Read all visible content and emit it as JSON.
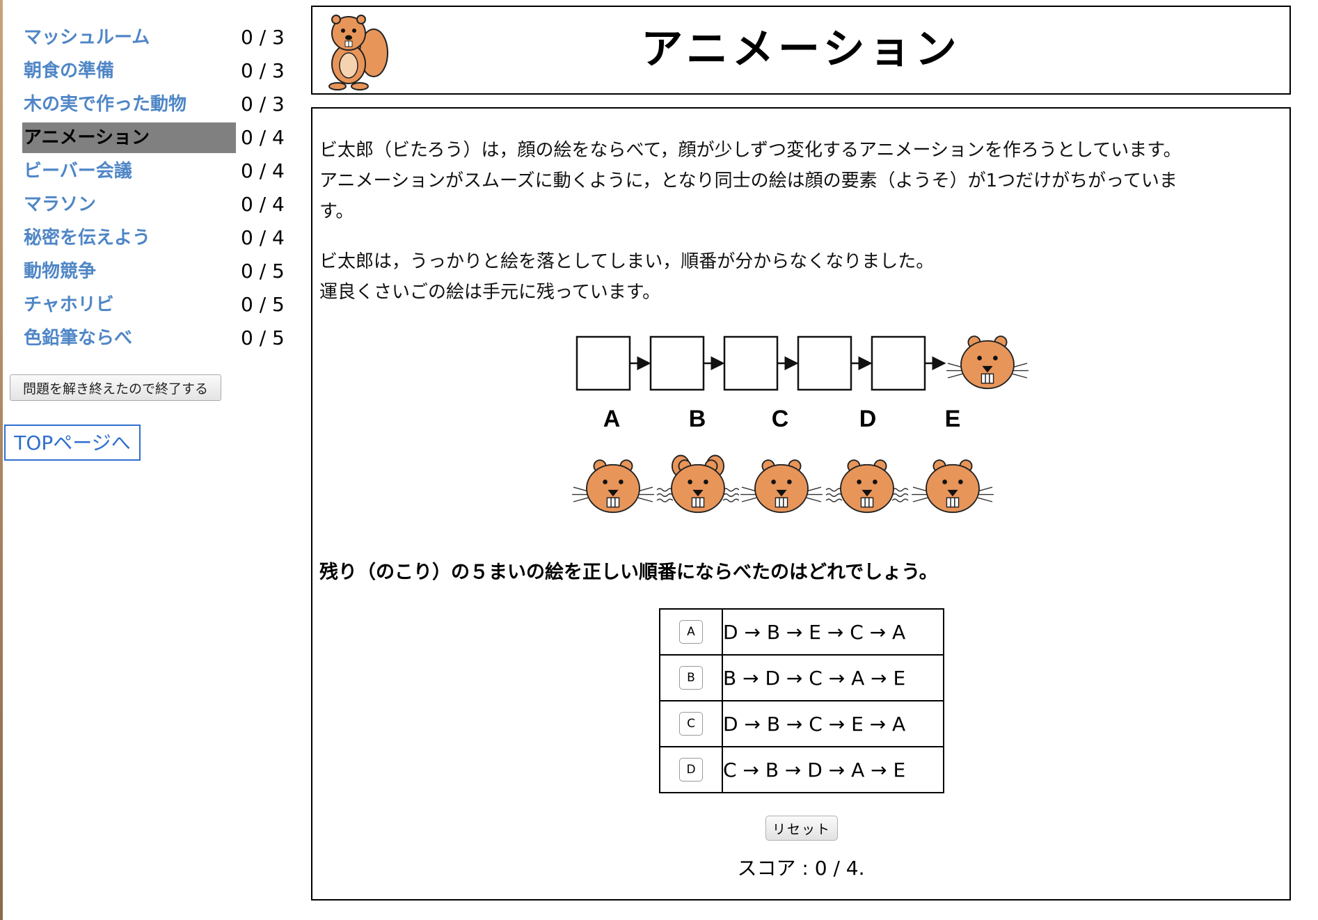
{
  "sidebar": {
    "tasks": [
      {
        "name": "マッシュルーム",
        "score": "0 / 3"
      },
      {
        "name": "朝食の準備",
        "score": "0 / 3"
      },
      {
        "name": "木の実で作った動物",
        "score": "0 / 3"
      },
      {
        "name": "アニメーション",
        "score": "0 / 4",
        "active": true
      },
      {
        "name": "ビーバー会議",
        "score": "0 / 4"
      },
      {
        "name": "マラソン",
        "score": "0 / 4"
      },
      {
        "name": "秘密を伝えよう",
        "score": "0 / 4"
      },
      {
        "name": "動物競争",
        "score": "0 / 5"
      },
      {
        "name": "チャホリビ",
        "score": "0 / 5"
      },
      {
        "name": "色鉛筆ならべ",
        "score": "0 / 5"
      }
    ],
    "finish_button": "問題を解き終えたので終了する",
    "top_link": "TOPページへ"
  },
  "header": {
    "title": "アニメーション"
  },
  "problem": {
    "p1_lines": [
      "ビ太郎（ビたろう）は，顔の絵をならべて，顔が少しずつ変化するアニメーションを作ろうとしています。",
      "アニメーションがスムーズに動くように，となり同士の絵は顔の要素（ようそ）が1つだけがちがっていま",
      "す。"
    ],
    "p2_lines": [
      "ビ太郎は，うっかりと絵を落としてしまい，順番が分からなくなりました。",
      "運良くさいごの絵は手元に残っています。"
    ],
    "figure_labels": [
      "A",
      "B",
      "C",
      "D",
      "E"
    ],
    "question": "残り（のこり）の５まいの絵を正しい順番にならべたのはどれでしょう。",
    "choices": [
      {
        "letter": "A",
        "sequence": "D → B → E → C → A"
      },
      {
        "letter": "B",
        "sequence": "B → D → C → A → E"
      },
      {
        "letter": "C",
        "sequence": "D → B → C → E → A"
      },
      {
        "letter": "D",
        "sequence": "C → B → D → A → E"
      }
    ],
    "reset_label": "リセット",
    "score_text": "スコア : 0 / 4."
  },
  "colors": {
    "link_blue": "#4f86c6",
    "active_bg": "#808080",
    "beaver_fill": "#e8955a",
    "top_link_blue": "#2f6fce"
  }
}
